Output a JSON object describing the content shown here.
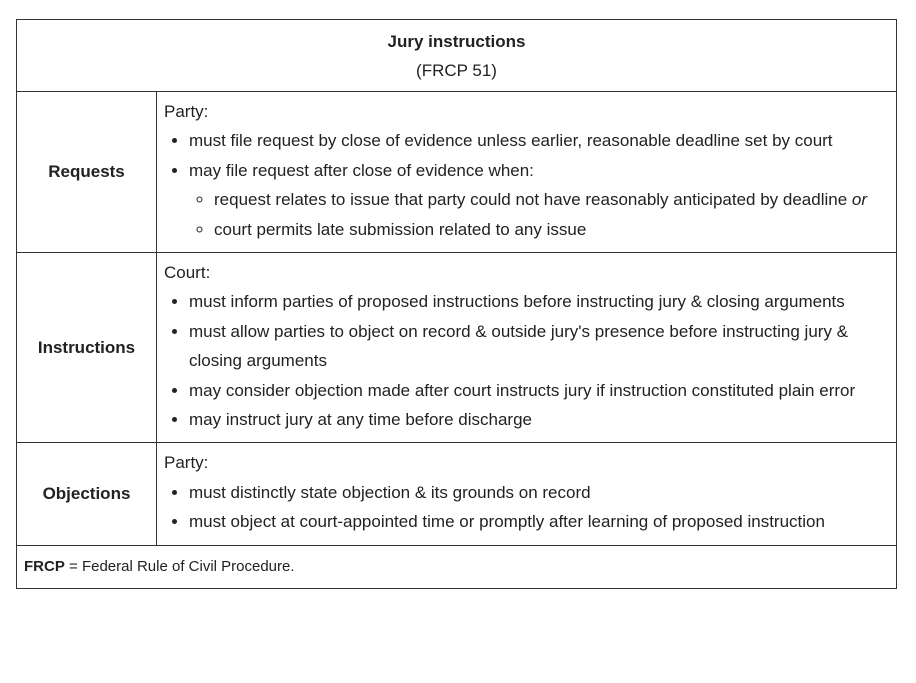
{
  "header": {
    "title": "Jury instructions",
    "subtitle": "(FRCP 51)"
  },
  "rows": {
    "requests": {
      "label": "Requests",
      "lead": "Party:",
      "items": [
        "must file request by close of evidence unless earlier, reasonable deadline set by court",
        "may file request after close of evidence when:"
      ],
      "subitems": {
        "first_text": "request relates to issue that party could not have reasonably anticipated by deadline",
        "first_connector": "or",
        "second_text": "court permits late submission related to any issue"
      }
    },
    "instructions": {
      "label": "Instructions",
      "lead": "Court:",
      "items": [
        "must inform parties of proposed instructions before instructing jury & closing arguments",
        "must allow parties to object on record & outside jury's presence before instructing jury & closing arguments",
        "may consider objection made after court instructs jury if instruction constituted plain error",
        "may instruct jury at any time before discharge"
      ]
    },
    "objections": {
      "label": "Objections",
      "lead": "Party:",
      "items": [
        "must distinctly state objection & its grounds on record",
        "must object at court-appointed time or promptly after learning of proposed instruction"
      ]
    }
  },
  "footer": {
    "abbr": "FRCP",
    "definition": " = Federal Rule of Civil Procedure."
  }
}
